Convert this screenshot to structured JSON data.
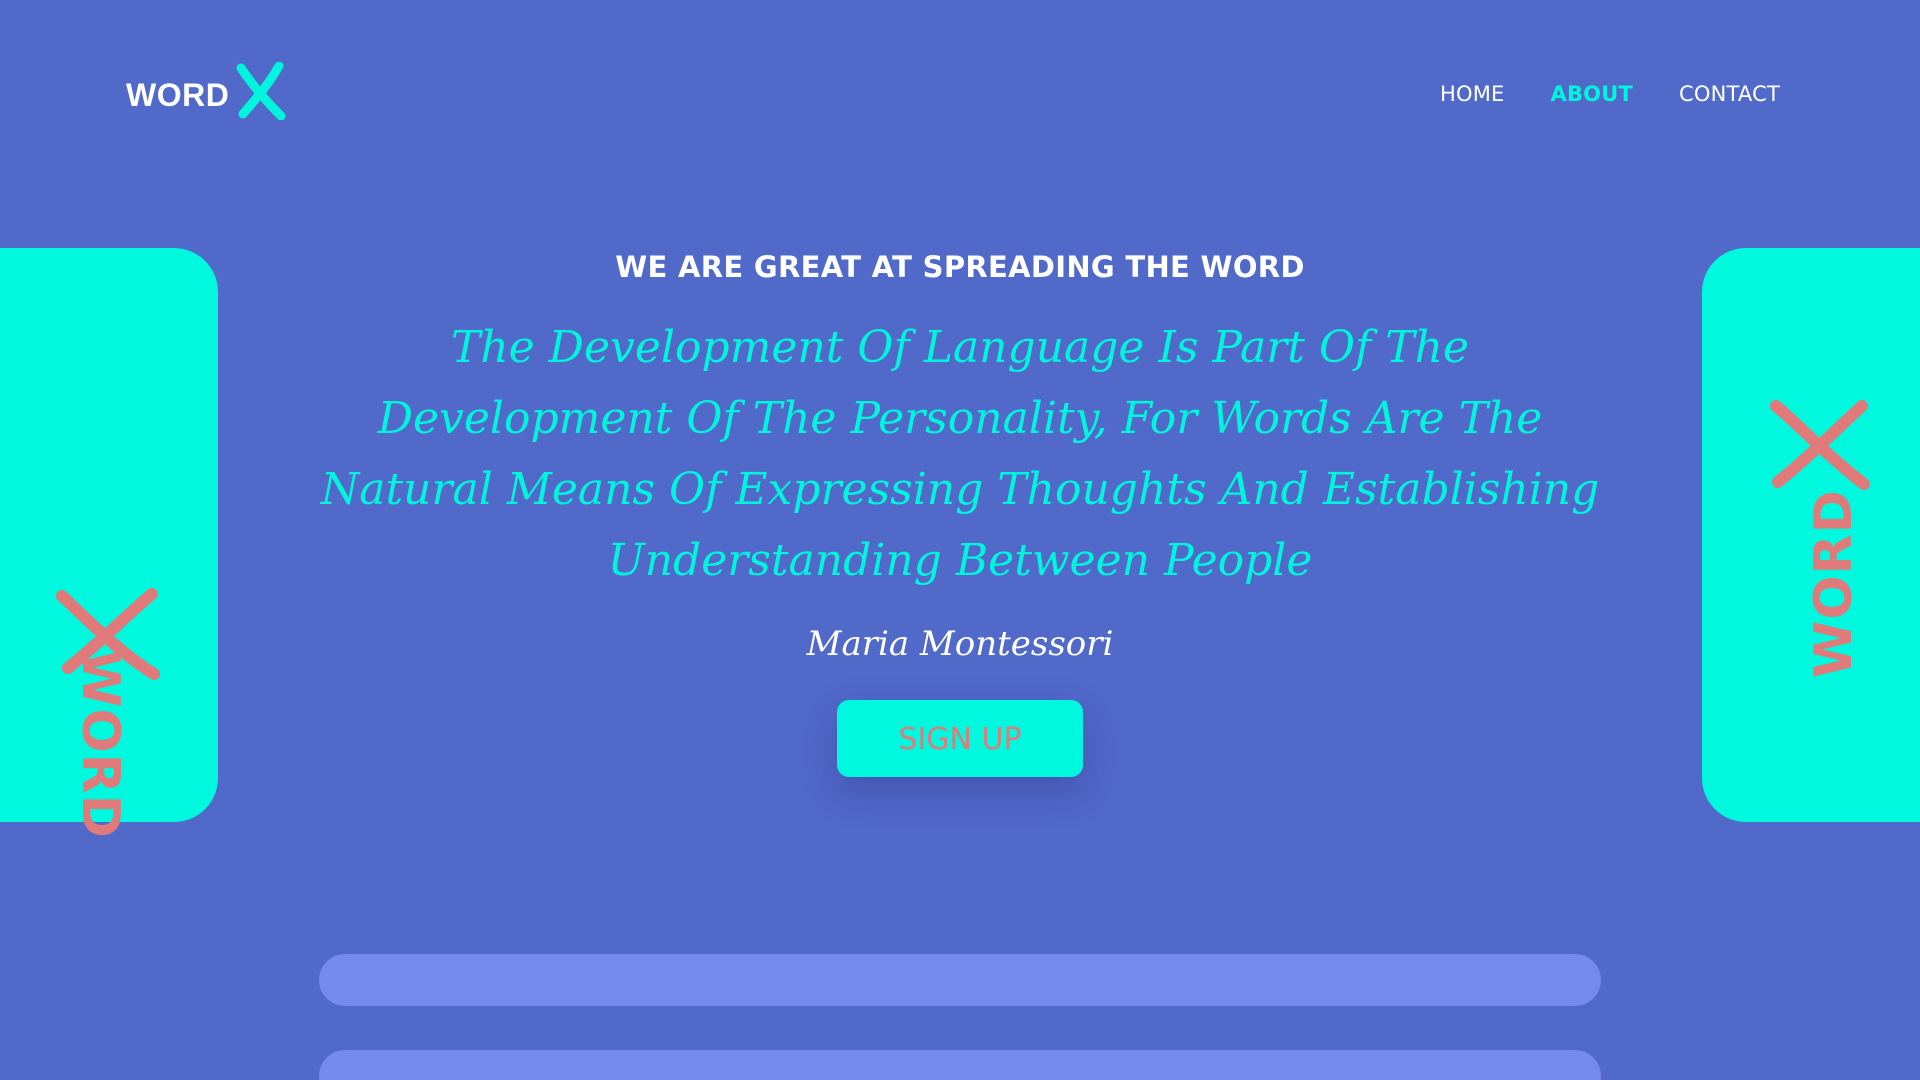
{
  "header": {
    "logo": {
      "word": "WORD",
      "mark": "X"
    },
    "nav": [
      {
        "label": "HOME",
        "active": false
      },
      {
        "label": "ABOUT",
        "active": true
      },
      {
        "label": "CONTACT",
        "active": false
      }
    ]
  },
  "side_cards": {
    "left": {
      "word": "WORD",
      "mark": "x-icon"
    },
    "right": {
      "word": "WORD",
      "mark": "x-icon"
    }
  },
  "main": {
    "eyebrow": "WE ARE GREAT AT SPREADING THE WORD",
    "quote": "The Development Of Language Is Part Of The Development Of The Personality, For Words Are The Natural Means Of Expressing Thoughts And Establishing Understanding Between People",
    "author": "Maria Montessori",
    "cta_label": "SIGN UP"
  },
  "colors": {
    "background": "#5169c9",
    "accent": "#00f5dc",
    "coral": "#e07a7a",
    "bar": "#7689ec"
  }
}
